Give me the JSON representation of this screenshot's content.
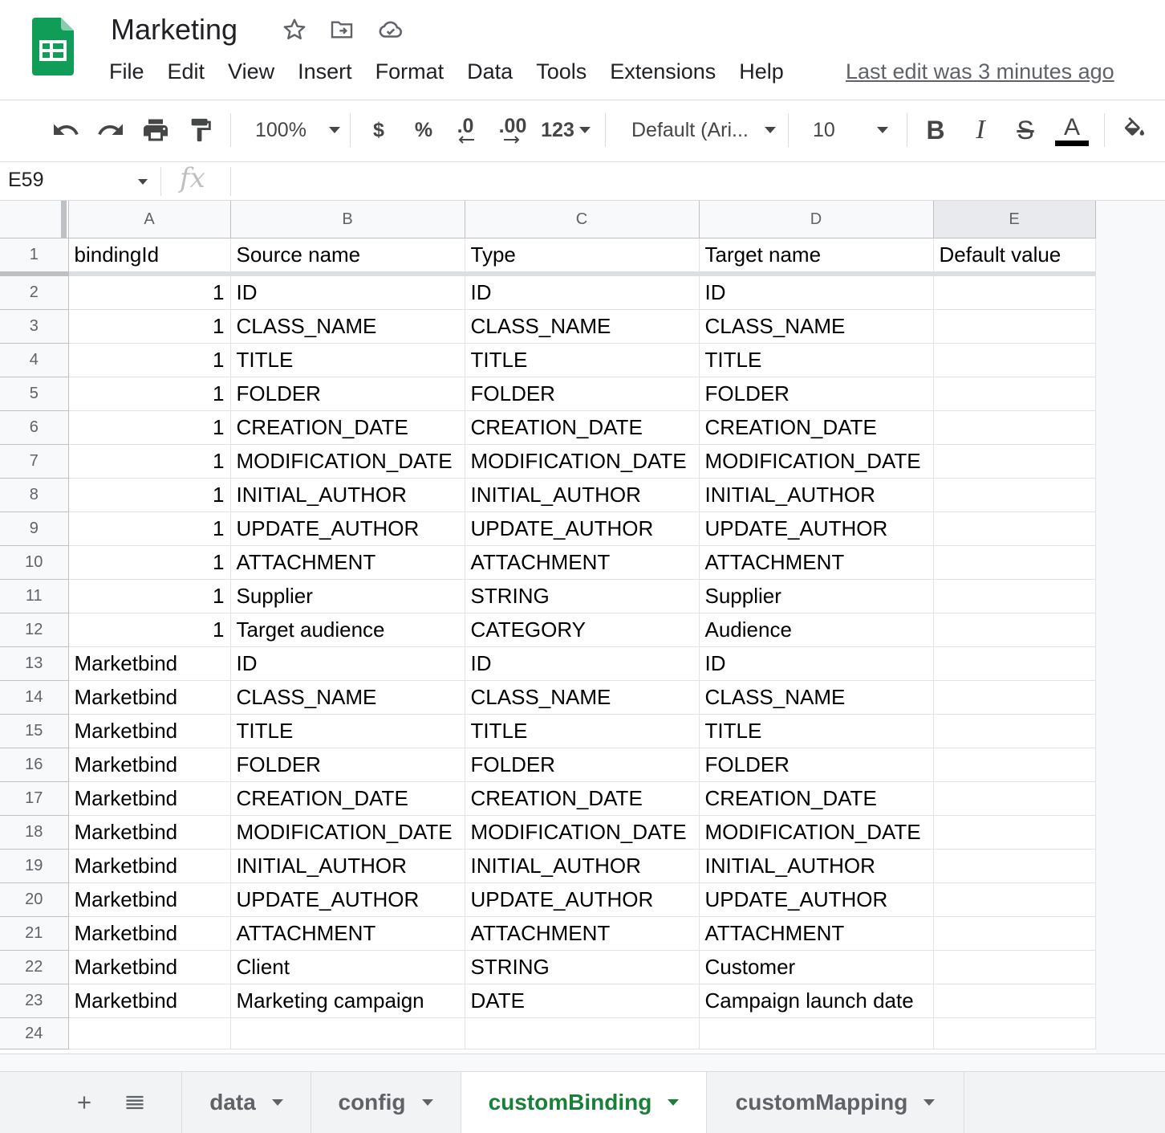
{
  "header": {
    "title": "Marketing",
    "menu": [
      "File",
      "Edit",
      "View",
      "Insert",
      "Format",
      "Data",
      "Tools",
      "Extensions",
      "Help"
    ],
    "last_edit": "Last edit was 3 minutes ago",
    "icons": [
      "star-icon",
      "move-to-folder-icon",
      "cloud-saved-icon"
    ]
  },
  "toolbar": {
    "zoom": "100%",
    "currency": "$",
    "percent": "%",
    "decrease_decimal": ".0",
    "increase_decimal": ".00",
    "more_formats": "123",
    "font": "Default (Ari...",
    "font_size": "10",
    "bold": "B",
    "italic": "I",
    "strike": "S",
    "text_color": "A"
  },
  "formula_bar": {
    "cell_ref": "E59",
    "fx": "fx",
    "value": ""
  },
  "sheet": {
    "columns": [
      "A",
      "B",
      "C",
      "D",
      "E"
    ],
    "selected_column": "E",
    "rows": [
      {
        "n": "1",
        "cells": [
          "bindingId",
          "Source name",
          "Type",
          "Target name",
          "Default value"
        ]
      },
      {
        "n": "2",
        "cells": [
          "1",
          "ID",
          "ID",
          "ID",
          ""
        ]
      },
      {
        "n": "3",
        "cells": [
          "1",
          "CLASS_NAME",
          "CLASS_NAME",
          "CLASS_NAME",
          ""
        ]
      },
      {
        "n": "4",
        "cells": [
          "1",
          "TITLE",
          "TITLE",
          "TITLE",
          ""
        ]
      },
      {
        "n": "5",
        "cells": [
          "1",
          "FOLDER",
          "FOLDER",
          "FOLDER",
          ""
        ]
      },
      {
        "n": "6",
        "cells": [
          "1",
          "CREATION_DATE",
          "CREATION_DATE",
          "CREATION_DATE",
          ""
        ]
      },
      {
        "n": "7",
        "cells": [
          "1",
          "MODIFICATION_DATE",
          "MODIFICATION_DATE",
          "MODIFICATION_DATE",
          ""
        ]
      },
      {
        "n": "8",
        "cells": [
          "1",
          "INITIAL_AUTHOR",
          "INITIAL_AUTHOR",
          "INITIAL_AUTHOR",
          ""
        ]
      },
      {
        "n": "9",
        "cells": [
          "1",
          "UPDATE_AUTHOR",
          "UPDATE_AUTHOR",
          "UPDATE_AUTHOR",
          ""
        ]
      },
      {
        "n": "10",
        "cells": [
          "1",
          "ATTACHMENT",
          "ATTACHMENT",
          "ATTACHMENT",
          ""
        ]
      },
      {
        "n": "11",
        "cells": [
          "1",
          "Supplier",
          "STRING",
          "Supplier",
          ""
        ]
      },
      {
        "n": "12",
        "cells": [
          "1",
          "Target audience",
          "CATEGORY",
          "Audience",
          ""
        ]
      },
      {
        "n": "13",
        "cells": [
          "Marketbind",
          "ID",
          "ID",
          "ID",
          ""
        ]
      },
      {
        "n": "14",
        "cells": [
          "Marketbind",
          "CLASS_NAME",
          "CLASS_NAME",
          "CLASS_NAME",
          ""
        ]
      },
      {
        "n": "15",
        "cells": [
          "Marketbind",
          "TITLE",
          "TITLE",
          "TITLE",
          ""
        ]
      },
      {
        "n": "16",
        "cells": [
          "Marketbind",
          "FOLDER",
          "FOLDER",
          "FOLDER",
          ""
        ]
      },
      {
        "n": "17",
        "cells": [
          "Marketbind",
          "CREATION_DATE",
          "CREATION_DATE",
          "CREATION_DATE",
          ""
        ]
      },
      {
        "n": "18",
        "cells": [
          "Marketbind",
          "MODIFICATION_DATE",
          "MODIFICATION_DATE",
          "MODIFICATION_DATE",
          ""
        ]
      },
      {
        "n": "19",
        "cells": [
          "Marketbind",
          "INITIAL_AUTHOR",
          "INITIAL_AUTHOR",
          "INITIAL_AUTHOR",
          ""
        ]
      },
      {
        "n": "20",
        "cells": [
          "Marketbind",
          "UPDATE_AUTHOR",
          "UPDATE_AUTHOR",
          "UPDATE_AUTHOR",
          ""
        ]
      },
      {
        "n": "21",
        "cells": [
          "Marketbind",
          "ATTACHMENT",
          "ATTACHMENT",
          "ATTACHMENT",
          ""
        ]
      },
      {
        "n": "22",
        "cells": [
          "Marketbind",
          "Client",
          "STRING",
          "Customer",
          ""
        ]
      },
      {
        "n": "23",
        "cells": [
          "Marketbind",
          "Marketing campaign",
          "DATE",
          "Campaign launch date",
          ""
        ]
      },
      {
        "n": "24",
        "cells": [
          "",
          "",
          "",
          "",
          ""
        ]
      }
    ]
  },
  "tabs": [
    {
      "label": "data",
      "active": false
    },
    {
      "label": "config",
      "active": false
    },
    {
      "label": "customBinding",
      "active": true
    },
    {
      "label": "customMapping",
      "active": false
    }
  ],
  "colors": {
    "brand_green": "#0f9d58",
    "active_tab": "#188038"
  }
}
